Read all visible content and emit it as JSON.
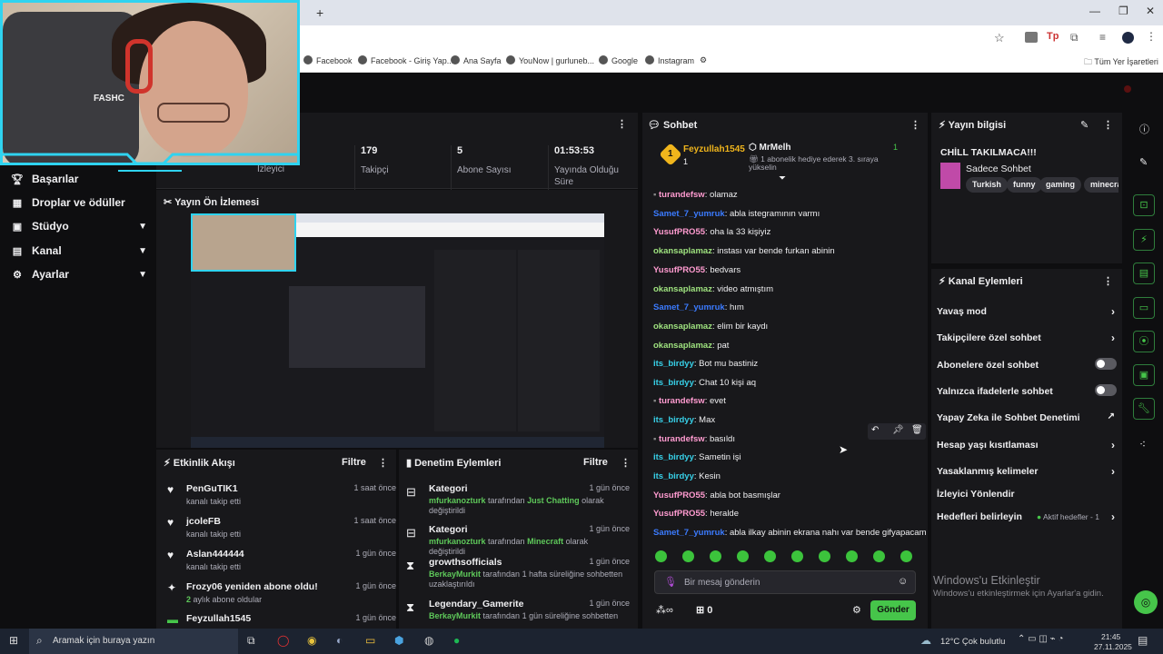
{
  "browser": {
    "new_tab": "+",
    "window_controls": [
      "—",
      "❐",
      "✕"
    ],
    "bookmarks": [
      "Facebook",
      "Facebook - Giriş Yap...",
      "Ana Sayfa",
      "YouNow | gurluneb...",
      "Google",
      "Instagram"
    ],
    "all_bookmarks": "Tüm Yer İşaretleri"
  },
  "webcam": {
    "overlay_text": "FASHC"
  },
  "sidebar": {
    "items": [
      {
        "label": "Başarılar",
        "icon": "trophy-icon"
      },
      {
        "label": "Droplar ve ödüller",
        "icon": "gift-icon"
      },
      {
        "label": "Stüdyo",
        "icon": "studio-icon"
      },
      {
        "label": "Kanal",
        "icon": "channel-icon"
      },
      {
        "label": "Ayarlar",
        "icon": "gear-icon"
      }
    ]
  },
  "stats": {
    "viewers_label": "İzleyici",
    "followers_value": "179",
    "followers_label": "Takipçi",
    "subs_value": "5",
    "subs_label": "Abone Sayısı",
    "uptime_value": "01:53:53",
    "uptime_label": "Yayında Olduğu Süre"
  },
  "preview": {
    "title": "Yayın Ön İzlemesi"
  },
  "activity": {
    "title": "Etkinlik Akışı",
    "filter": "Filtre",
    "items": [
      {
        "name": "PenGuTIK1",
        "sub": "kanalı takip etti",
        "time": "1 saat önce",
        "icon": "heart-icon"
      },
      {
        "name": "jcoleFB",
        "sub": "kanalı takip etti",
        "time": "1 saat önce",
        "icon": "heart-icon"
      },
      {
        "name": "Aslan444444",
        "sub": "kanalı takip etti",
        "time": "1 gün önce",
        "icon": "heart-icon"
      },
      {
        "name": "Frozy06 yeniden abone oldu!",
        "sub_green": "2",
        "sub": " aylık abone oldular",
        "time": "1 gün önce",
        "icon": "sparkle-icon"
      },
      {
        "name": "Feyzullah1545",
        "sub": "",
        "time": "1 gün önce",
        "icon": "gift-icon"
      }
    ]
  },
  "moderation": {
    "title": "Denetim Eylemleri",
    "filter": "Filtre",
    "items": [
      {
        "name": "Kategori",
        "user": "mfurkanozturk",
        "mid": " tarafından ",
        "target": "Just Chatting",
        "rest": " olarak değiştirildi",
        "time": "1 gün önce",
        "icon": "category-icon"
      },
      {
        "name": "Kategori",
        "user": "mfurkanozturk",
        "mid": " tarafından ",
        "target": "Minecraft",
        "rest": " olarak değiştirildi",
        "time": "1 gün önce",
        "icon": "category-icon"
      },
      {
        "name": "growthsofficials",
        "user": "BerkayMurkit",
        "mid": " tarafından 1 hafta süreliğine sohbetten uzaklaştırıldı",
        "target": "",
        "rest": "",
        "time": "1 gün önce",
        "icon": "hourglass-icon"
      },
      {
        "name": "Legendary_Gamerite",
        "user": "BerkayMurkit",
        "mid": " tarafından 1 gün süreliğine sohbetten",
        "target": "",
        "rest": "",
        "time": "1 gün önce",
        "icon": "hourglass-icon"
      }
    ]
  },
  "chat": {
    "title": "Sohbet",
    "top_gifter": {
      "name": "Feyzullah1545",
      "rank": "1",
      "count": "1"
    },
    "gift_banner": {
      "name": "MrMelh",
      "count": "1",
      "text": "1 abonelik hediye ederek 3. sıraya yükselin"
    },
    "messages": [
      {
        "user": "turandefsw",
        "color": "#ff9bd0",
        "text": "olamaz",
        "badge": true
      },
      {
        "user": "Samet_7_yumruk",
        "color": "#3b7bff",
        "text": "abla istegramının varmı",
        "badge": false
      },
      {
        "user": "YusufPRO55",
        "color": "#ff9bd0",
        "text": "oha la 33 kişiyiz",
        "badge": false
      },
      {
        "user": "okansaplamaz",
        "color": "#9fe37f",
        "text": "instası var bende furkan abinin",
        "badge": false
      },
      {
        "user": "YusufPRO55",
        "color": "#ff9bd0",
        "text": "bedvars",
        "badge": false
      },
      {
        "user": "okansaplamaz",
        "color": "#9fe37f",
        "text": "video atmıştım",
        "badge": false
      },
      {
        "user": "Samet_7_yumruk",
        "color": "#3b7bff",
        "text": "hım",
        "badge": false
      },
      {
        "user": "okansaplamaz",
        "color": "#9fe37f",
        "text": "elim bir kaydı",
        "badge": false
      },
      {
        "user": "okansaplamaz",
        "color": "#9fe37f",
        "text": "pat",
        "badge": false
      },
      {
        "user": "its_birdyy",
        "color": "#37d0e8",
        "text": "Bot mu bastiniz",
        "badge": false
      },
      {
        "user": "its_birdyy",
        "color": "#37d0e8",
        "text": "Chat 10 kişi aq",
        "badge": false
      },
      {
        "user": "turandefsw",
        "color": "#ff9bd0",
        "text": "evet",
        "badge": true
      },
      {
        "user": "its_birdyy",
        "color": "#37d0e8",
        "text": "Max",
        "badge": false
      },
      {
        "user": "turandefsw",
        "color": "#ff9bd0",
        "text": "basıldı",
        "badge": true
      },
      {
        "user": "its_birdyy",
        "color": "#37d0e8",
        "text": "Sametin işi",
        "badge": false
      },
      {
        "user": "its_birdyy",
        "color": "#37d0e8",
        "text": "Kesin",
        "badge": false
      },
      {
        "user": "YusufPRO55",
        "color": "#ff9bd0",
        "text": "abla bot basmışlar",
        "badge": false
      },
      {
        "user": "YusufPRO55",
        "color": "#ff9bd0",
        "text": "heralde",
        "badge": false
      },
      {
        "user": "Samet_7_yumruk",
        "color": "#3b7bff",
        "text": "abla ilkay abinin ekrana nahı var bende gifyapacam",
        "badge": false
      }
    ],
    "placeholder": "Bir mesaj gönderin",
    "points": "0",
    "send": "Gönder"
  },
  "stream_info": {
    "title": "Yayın bilgisi",
    "stream_title": "CHİLL TAKILMACA!!!",
    "category": "Sadece Sohbet",
    "tags": [
      "Turkish",
      "funny",
      "gaming",
      "minecra"
    ]
  },
  "channel_actions": {
    "title": "Kanal Eylemleri",
    "items": [
      {
        "label": "Yavaş mod",
        "kind": "chevron"
      },
      {
        "label": "Takipçilere özel sohbet",
        "kind": "chevron"
      },
      {
        "label": "Abonelere özel sohbet",
        "kind": "toggle"
      },
      {
        "label": "Yalnızca ifadelerle sohbet",
        "kind": "toggle"
      },
      {
        "label": "Yapay Zeka ile Sohbet Denetimi",
        "kind": "external"
      },
      {
        "label": "Hesap yaşı kısıtlaması",
        "kind": "chevron"
      },
      {
        "label": "Yasaklanmış kelimeler",
        "kind": "chevron"
      },
      {
        "label": "İzleyici Yönlendir",
        "kind": "none"
      },
      {
        "label": "Hedefleri belirleyin",
        "kind": "goal"
      }
    ],
    "goal_status": "Aktif hedefler - 1"
  },
  "watermark": {
    "line1": "Windows'u Etkinleştir",
    "line2": "Windows'u etkinleştirmek için Ayarlar'a gidin."
  },
  "taskbar": {
    "search_placeholder": "Aramak için buraya yazın",
    "weather": "12°C  Çok bulutlu",
    "time": "21:45",
    "date": "27.11.2025"
  }
}
